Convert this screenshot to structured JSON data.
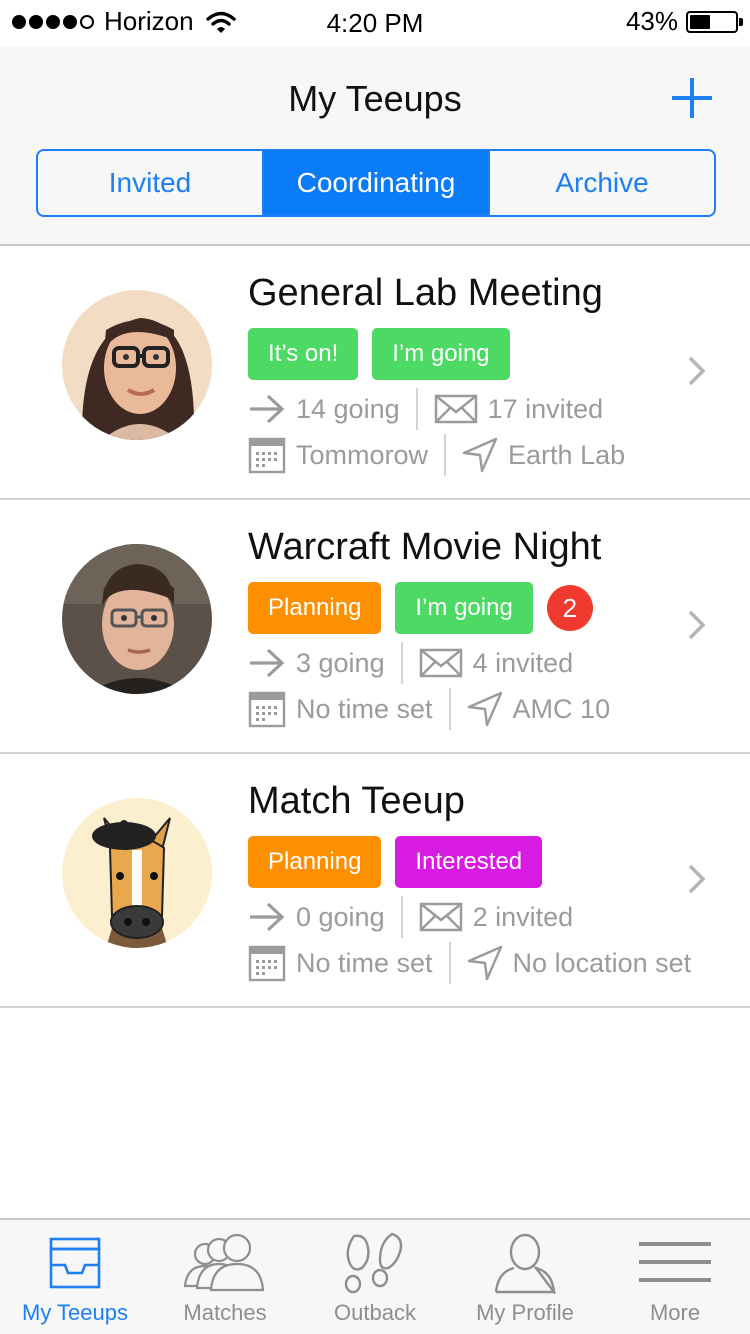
{
  "status_bar": {
    "carrier": "Horizon",
    "time": "4:20 PM",
    "battery": "43%",
    "signal_bars": 4
  },
  "header": {
    "title": "My Teeups",
    "add_icon": "plus-icon",
    "accent_color": "#1e7ff4"
  },
  "segments": [
    {
      "label": "Invited",
      "active": false
    },
    {
      "label": "Coordinating",
      "active": true
    },
    {
      "label": "Archive",
      "active": false
    }
  ],
  "teeups": [
    {
      "title": "General Lab Meeting",
      "status": "It’s on!",
      "response": "I’m going",
      "going": "14 going",
      "invited": "17 invited",
      "when": "Tommorow",
      "where": "Earth Lab",
      "avatar": "woman-with-glasses-photo"
    },
    {
      "title": "Warcraft Movie Night",
      "status": "Planning",
      "response": "I’m going",
      "badge": "2",
      "going": "3 going",
      "invited": "4 invited",
      "when": "No time set",
      "where": "AMC 10",
      "avatar": "man-with-glasses-photo"
    },
    {
      "title": "Match Teeup",
      "status": "Planning",
      "response": "Interested",
      "going": "0 going",
      "invited": "2 invited",
      "when": "No time set",
      "where": "No location set",
      "avatar": "cartoon-horse-illustration"
    }
  ],
  "tab_bar": [
    {
      "label": "My Teeups",
      "icon": "inbox-tray-icon",
      "active": true
    },
    {
      "label": "Matches",
      "icon": "people-group-icon",
      "active": false
    },
    {
      "label": "Outback",
      "icon": "footprints-icon",
      "active": false
    },
    {
      "label": "My Profile",
      "icon": "person-icon",
      "active": false
    },
    {
      "label": "More",
      "icon": "hamburger-menu-icon",
      "active": false
    }
  ]
}
